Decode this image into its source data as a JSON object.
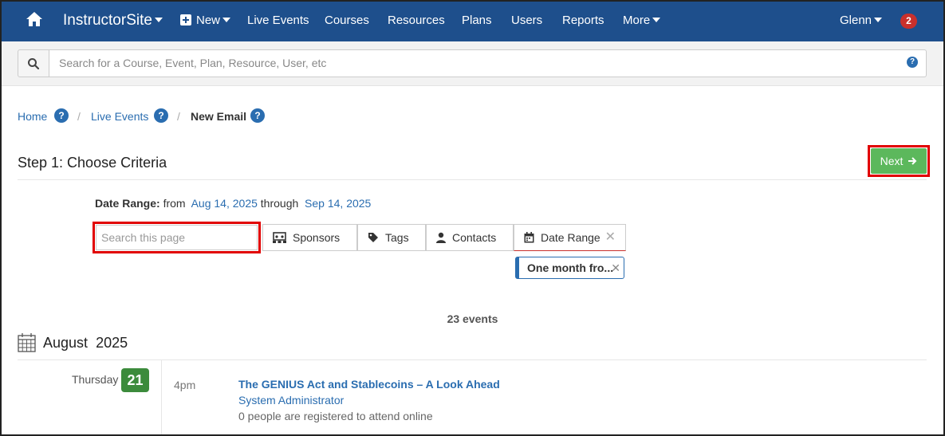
{
  "nav": {
    "brand": "InstructorSite",
    "new_label": "New",
    "items": [
      "Live Events",
      "Courses",
      "Resources",
      "Plans",
      "Users",
      "Reports"
    ],
    "more_label": "More",
    "user_label": "Glenn",
    "notification_count": "2"
  },
  "search": {
    "placeholder": "Search for a Course, Event, Plan, Resource, User, etc"
  },
  "breadcrumb": {
    "home": "Home",
    "live_events": "Live Events",
    "current": "New Email",
    "separator": "/"
  },
  "step": {
    "title": "Step 1: Choose Criteria",
    "next_label": "Next"
  },
  "date_range": {
    "label": "Date Range:",
    "from_word": "from",
    "from_date": "Aug 14, 2025",
    "through_word": "through",
    "to_date": "Sep 14, 2025"
  },
  "filters": {
    "search_placeholder": "Search this page",
    "tabs": [
      "Sponsors",
      "Tags",
      "Contacts",
      "Date Range"
    ],
    "active_chip": "One month fro..."
  },
  "events": {
    "count_text": "23 events",
    "month": "August",
    "year": "2025",
    "day_name": "Thursday",
    "day_number": "21",
    "items": [
      {
        "time": "4pm",
        "title": "The GENIUS Act and Stablecoins – A Look Ahead",
        "owner": "System Administrator",
        "registration": "0 people are registered to attend online"
      }
    ]
  },
  "colors": {
    "nav_bg": "#1e4f8c",
    "link": "#2a6db0",
    "next_green": "#5cb85c",
    "day_badge_green": "#3c8b3c",
    "notification_red": "#c9302c",
    "highlight_red": "#e10000"
  },
  "icons": {
    "home": "home-icon",
    "new": "plus-square-icon",
    "search": "search-icon",
    "help": "question-circle-icon",
    "sponsors": "sponsors-icon",
    "tags": "tag-icon",
    "contacts": "user-icon",
    "date_range": "calendar-icon",
    "next": "arrow-right-icon"
  }
}
